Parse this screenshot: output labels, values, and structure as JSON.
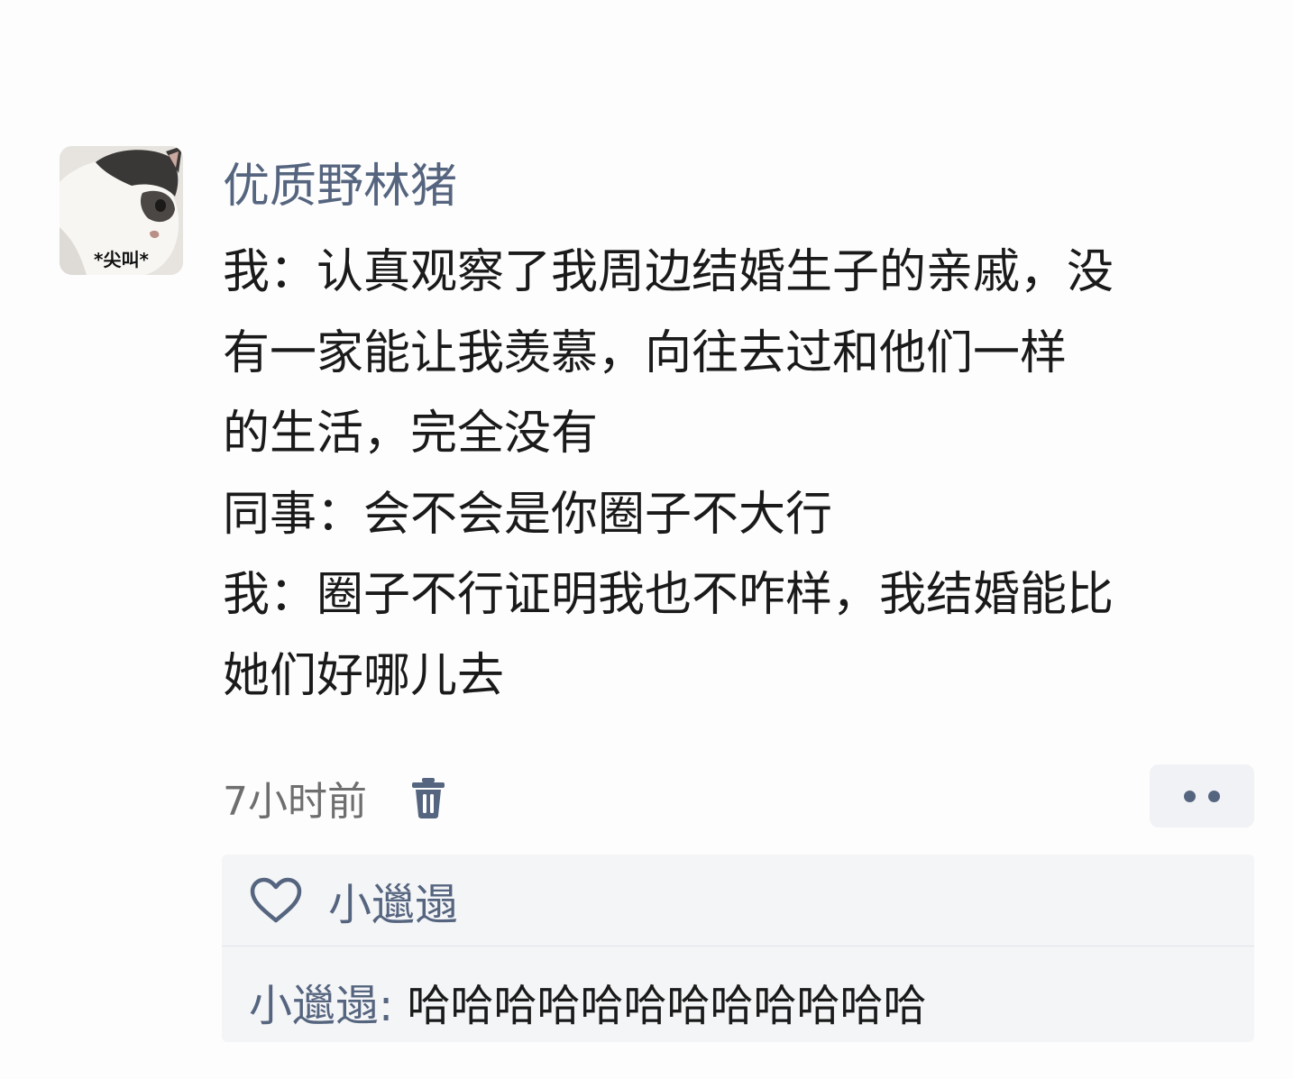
{
  "avatar": {
    "caption": "*尖叫*",
    "icon": "cat-avatar-image"
  },
  "comment": {
    "author": "优质野林猪",
    "lines": [
      "我：认真观察了我周边结婚生子的亲戚，没",
      "有一家能让我羡慕，向往去过和他们一样",
      "的生活，完全没有",
      "同事：会不会是你圈子不大行",
      "我：圈子不行证明我也不咋样，我结婚能比",
      "她们好哪儿去"
    ],
    "timestamp": "7小时前",
    "delete_icon": "trash-icon",
    "more_icon": "more-dots-icon"
  },
  "likes": {
    "icon": "heart-icon",
    "users": "小邋遢"
  },
  "reply": {
    "author": "小邋遢",
    "separator": ": ",
    "text": "哈哈哈哈哈哈哈哈哈哈哈哈"
  },
  "colors": {
    "accent": "#56657f",
    "text": "#1a1a1a",
    "muted": "#6e6e6e",
    "panel": "#f4f5f7"
  }
}
